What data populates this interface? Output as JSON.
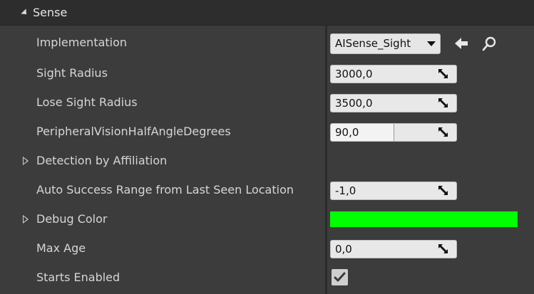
{
  "section": {
    "title": "Sense"
  },
  "rows": {
    "implementation": {
      "label": "Implementation",
      "value": "AISense_Sight"
    },
    "sight_radius": {
      "label": "Sight Radius",
      "value": "3000,0"
    },
    "lose_sight_radius": {
      "label": "Lose Sight Radius",
      "value": "3500,0"
    },
    "peripheral": {
      "label": "PeripheralVisionHalfAngleDegrees",
      "value": "90,0",
      "fraction": 0.5
    },
    "detection": {
      "label": "Detection by Affiliation"
    },
    "auto_success": {
      "label": "Auto Success Range from Last Seen Location",
      "value": "-1,0"
    },
    "debug_color": {
      "label": "Debug Color",
      "color": "#00ff00"
    },
    "max_age": {
      "label": "Max Age",
      "value": "0,0"
    },
    "starts_enabled": {
      "label": "Starts Enabled",
      "checked": true
    }
  },
  "icons": {
    "browse": "arrow-left-icon",
    "find": "search-icon",
    "drag": "resize-arrow-icon",
    "expand": "triangle-right-icon",
    "check": "check-icon"
  }
}
